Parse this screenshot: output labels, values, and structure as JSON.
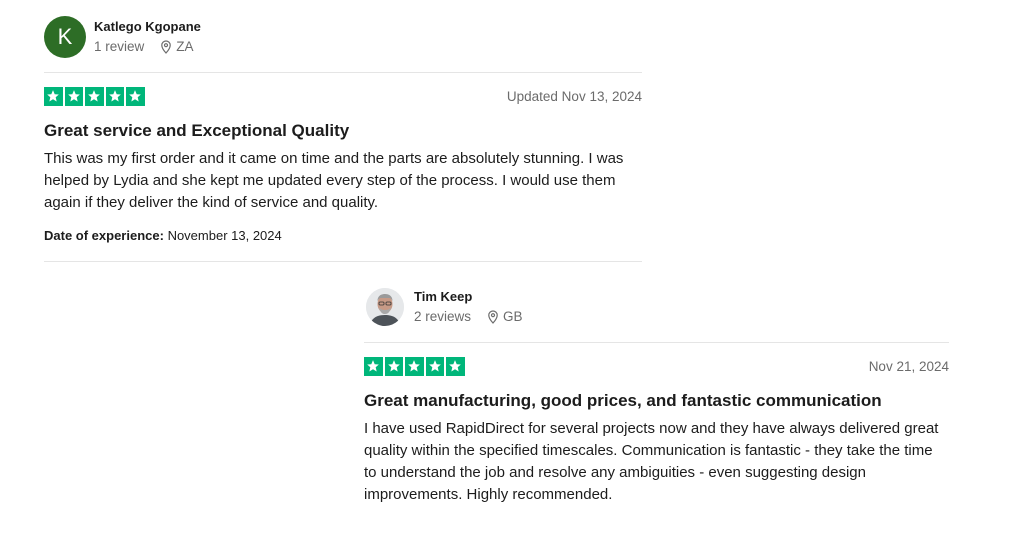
{
  "reviews": [
    {
      "reviewer_name": "Katlego Kgopane",
      "avatar_initial": "K",
      "review_count": "1 review",
      "country": "ZA",
      "stars": 5,
      "date": "Updated Nov 13, 2024",
      "title": "Great service and Exceptional Quality",
      "body": "This was my first order and it came on time and the parts are absolutely stunning. I was helped by Lydia and she kept me updated every step of the process. I would use them again if they deliver the kind of service and quality.",
      "experience_label": "Date of experience:",
      "experience_date": "November 13, 2024"
    },
    {
      "reviewer_name": "Tim Keep",
      "review_count": "2 reviews",
      "country": "GB",
      "stars": 5,
      "date": "Nov 21, 2024",
      "title": "Great manufacturing, good prices, and fantastic communication",
      "body": "I have used RapidDirect for several projects now and they have always delivered great quality within the specified timescales. Communication is fantastic - they take the time to understand the job and resolve any ambiguities - even suggesting design improvements. Highly recommended."
    }
  ],
  "colors": {
    "star_green": "#00b67a",
    "avatar_green": "#2d6d26",
    "muted_text": "#6b6b6b"
  },
  "icons": {
    "location": "location-pin-icon",
    "star": "star-icon"
  }
}
